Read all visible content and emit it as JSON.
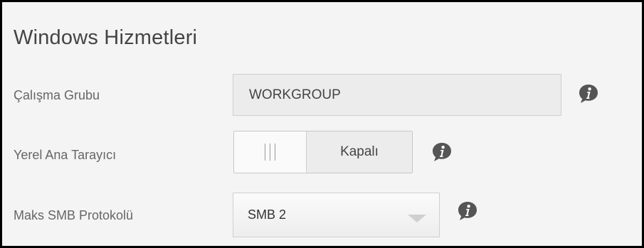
{
  "section": {
    "title": "Windows Hizmetleri"
  },
  "workgroup": {
    "label": "Çalışma Grubu",
    "value": "WORKGROUP",
    "info_icon": "info-icon"
  },
  "local_master_browser": {
    "label": "Yerel Ana Tarayıcı",
    "state_label": "Kapalı",
    "enabled": false,
    "info_icon": "info-icon"
  },
  "max_smb_protocol": {
    "label": "Maks SMB Protokolü",
    "selected": "SMB 2",
    "info_icon": "info-icon"
  },
  "colors": {
    "panel_bg": "#f4f4f4",
    "field_bg": "#ececec",
    "icon_fill": "#555555"
  }
}
